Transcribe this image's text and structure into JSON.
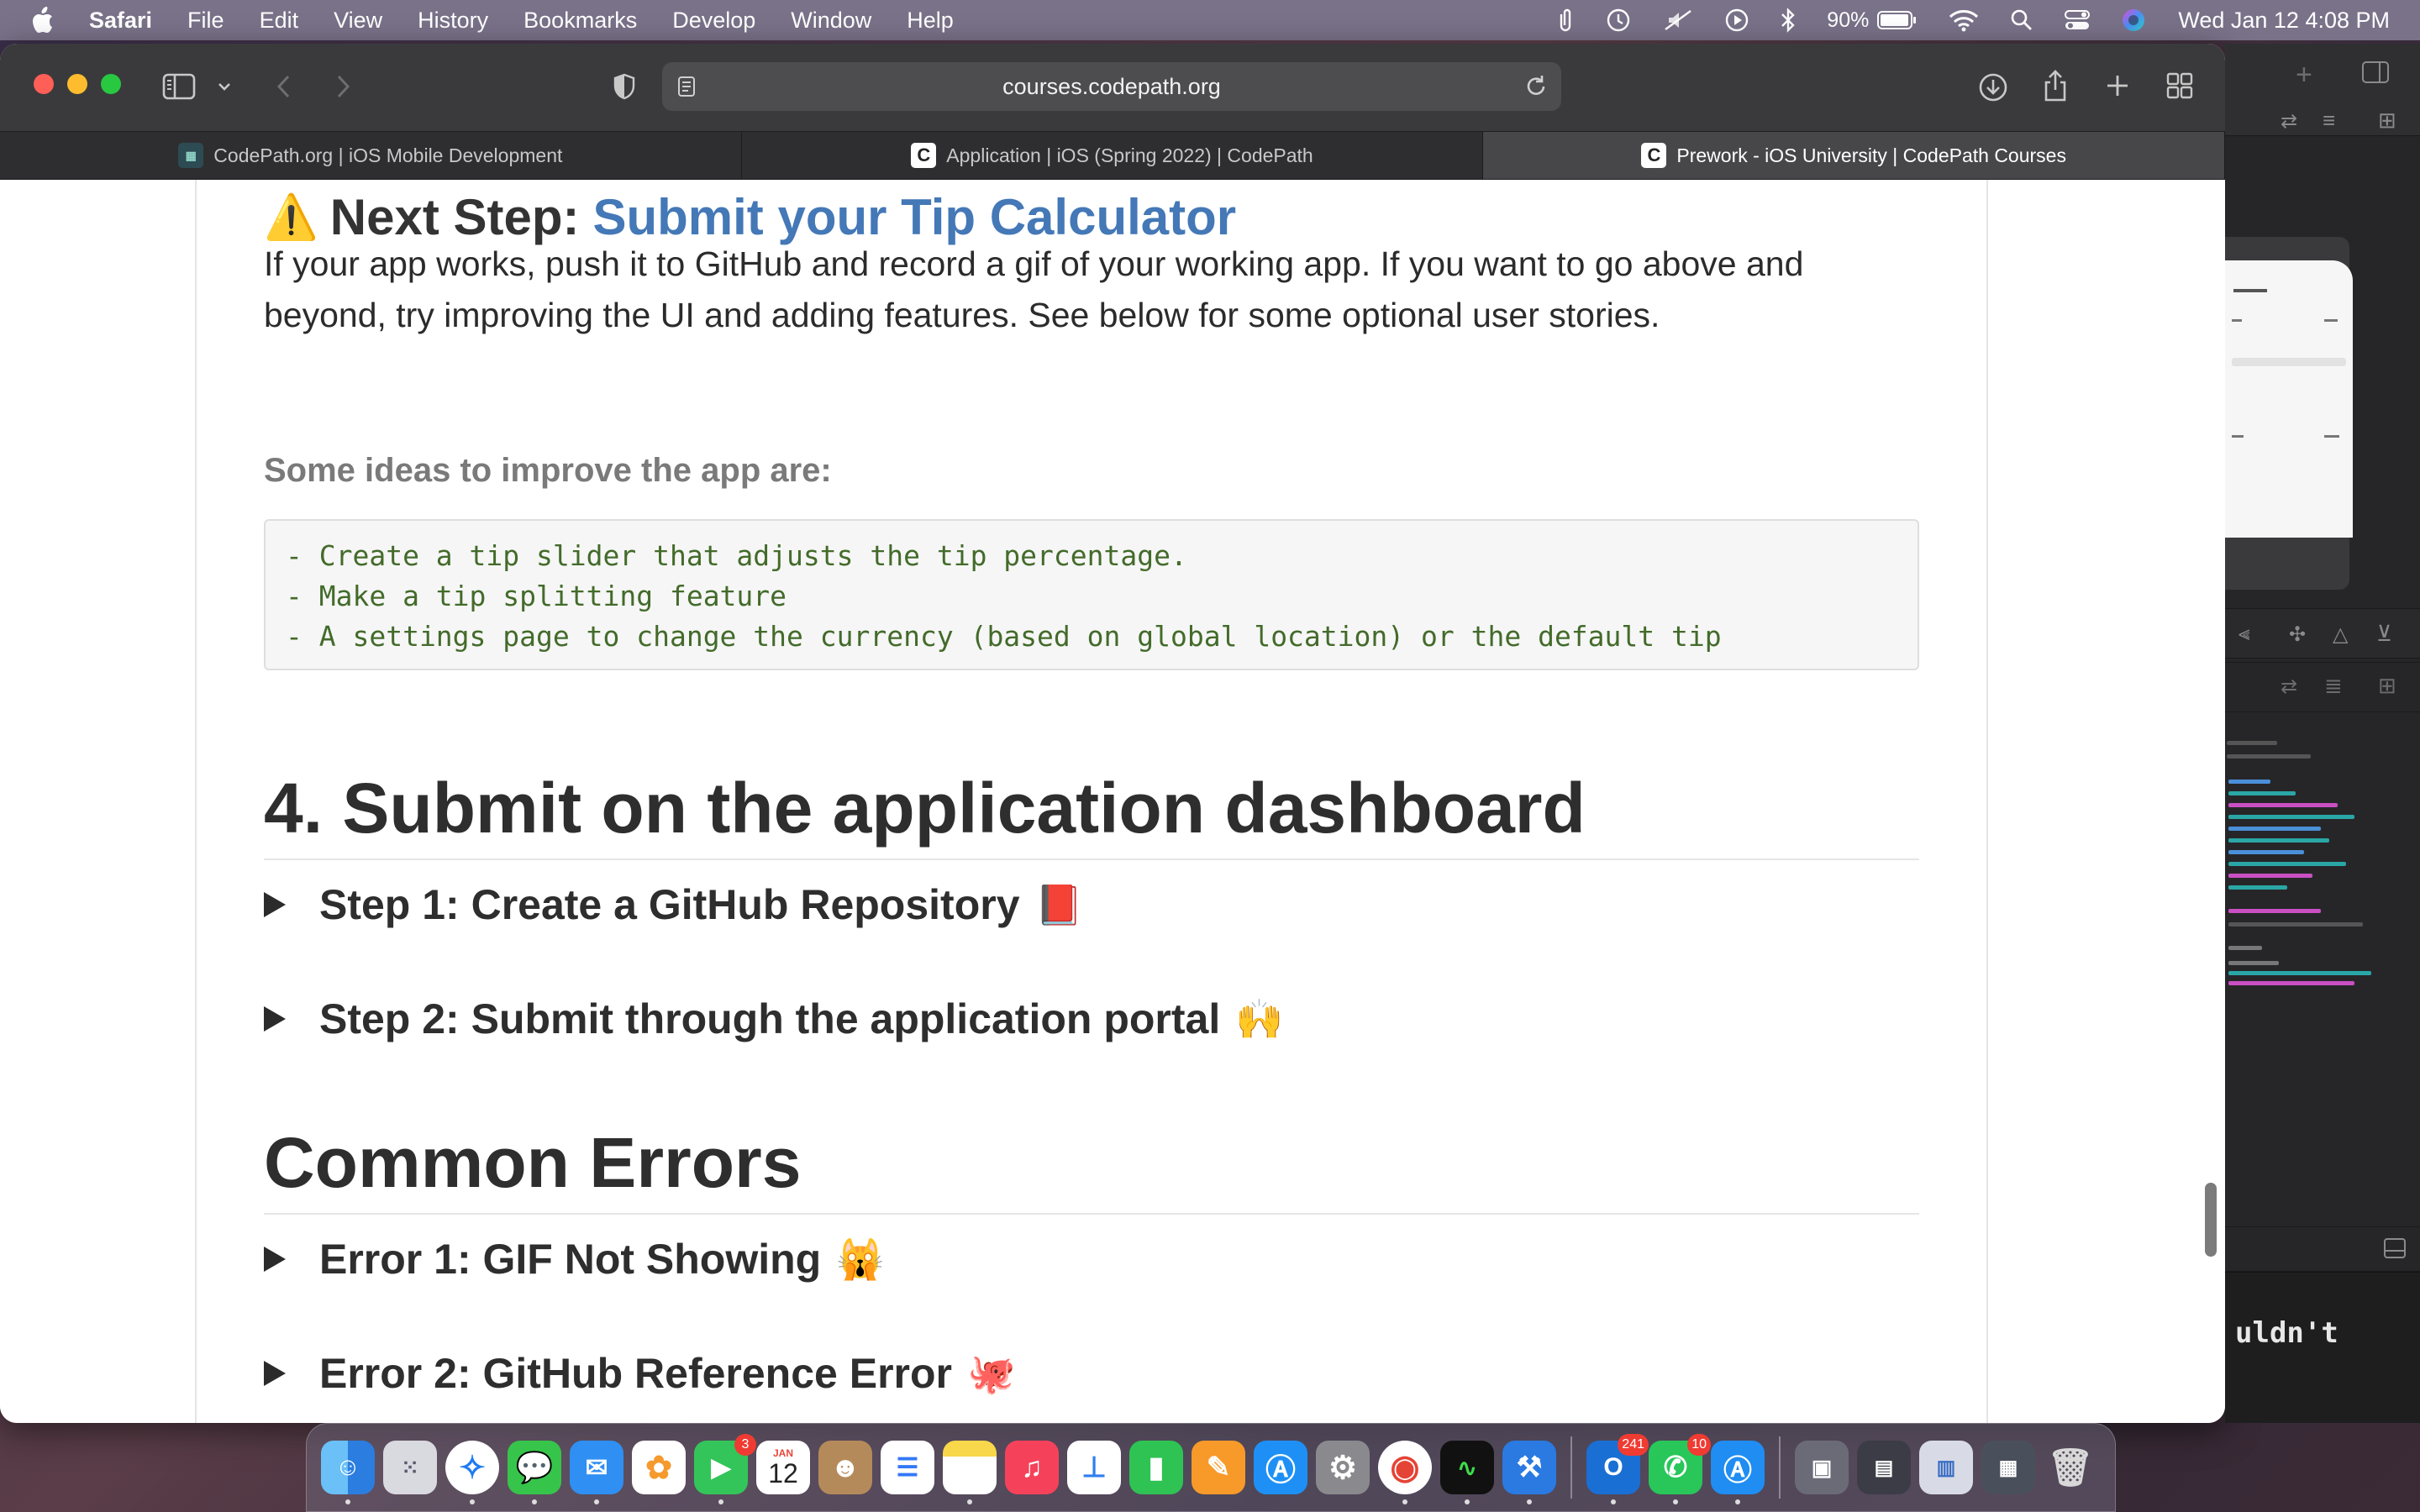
{
  "menubar": {
    "app_name": "Safari",
    "items": [
      "File",
      "Edit",
      "View",
      "History",
      "Bookmarks",
      "Develop",
      "Window",
      "Help"
    ],
    "battery_percent": "90%",
    "clock": "Wed Jan 12  4:08 PM"
  },
  "browser": {
    "url": "courses.codepath.org",
    "tabs": [
      {
        "title": "CodePath.org | iOS Mobile Development",
        "active": false
      },
      {
        "title": "Application | iOS (Spring 2022) | CodePath",
        "active": false
      },
      {
        "title": "Prework - iOS University | CodePath Courses",
        "active": true
      }
    ]
  },
  "page": {
    "next_step_emoji": "⚠️",
    "next_step_prefix": "Next Step:",
    "next_step_link": "Submit your Tip Calculator",
    "intro_text": "If your app works, push it to GitHub and record a gif of your working app. If you want to go above and beyond, try improving the UI and adding features. See below for some optional user stories.",
    "ideas_heading": "Some ideas to improve the app are:",
    "ideas_code": [
      "- Create a tip slider that adjusts the tip percentage.",
      "- Make a tip splitting feature",
      "- A settings page to change the currency (based on global location) or the default tip"
    ],
    "section_submit": "4. Submit on the application dashboard",
    "step1": {
      "label": "Step 1: Create a GitHub Repository",
      "emoji": "📕"
    },
    "step2": {
      "label": "Step 2: Submit through the application portal",
      "emoji": "🙌"
    },
    "section_errors": "Common Errors",
    "error1": {
      "label": "Error 1: GIF Not Showing",
      "emoji": "🙀"
    },
    "error2": {
      "label": "Error 2: GitHub Reference Error",
      "emoji": "🐙"
    }
  },
  "xcode": {
    "console_text": "uldn't"
  },
  "dock": {
    "calendar_month": "JAN",
    "calendar_day": "12",
    "badges": {
      "facetime": "3",
      "outlook": "241",
      "whatsapp": "10"
    }
  }
}
